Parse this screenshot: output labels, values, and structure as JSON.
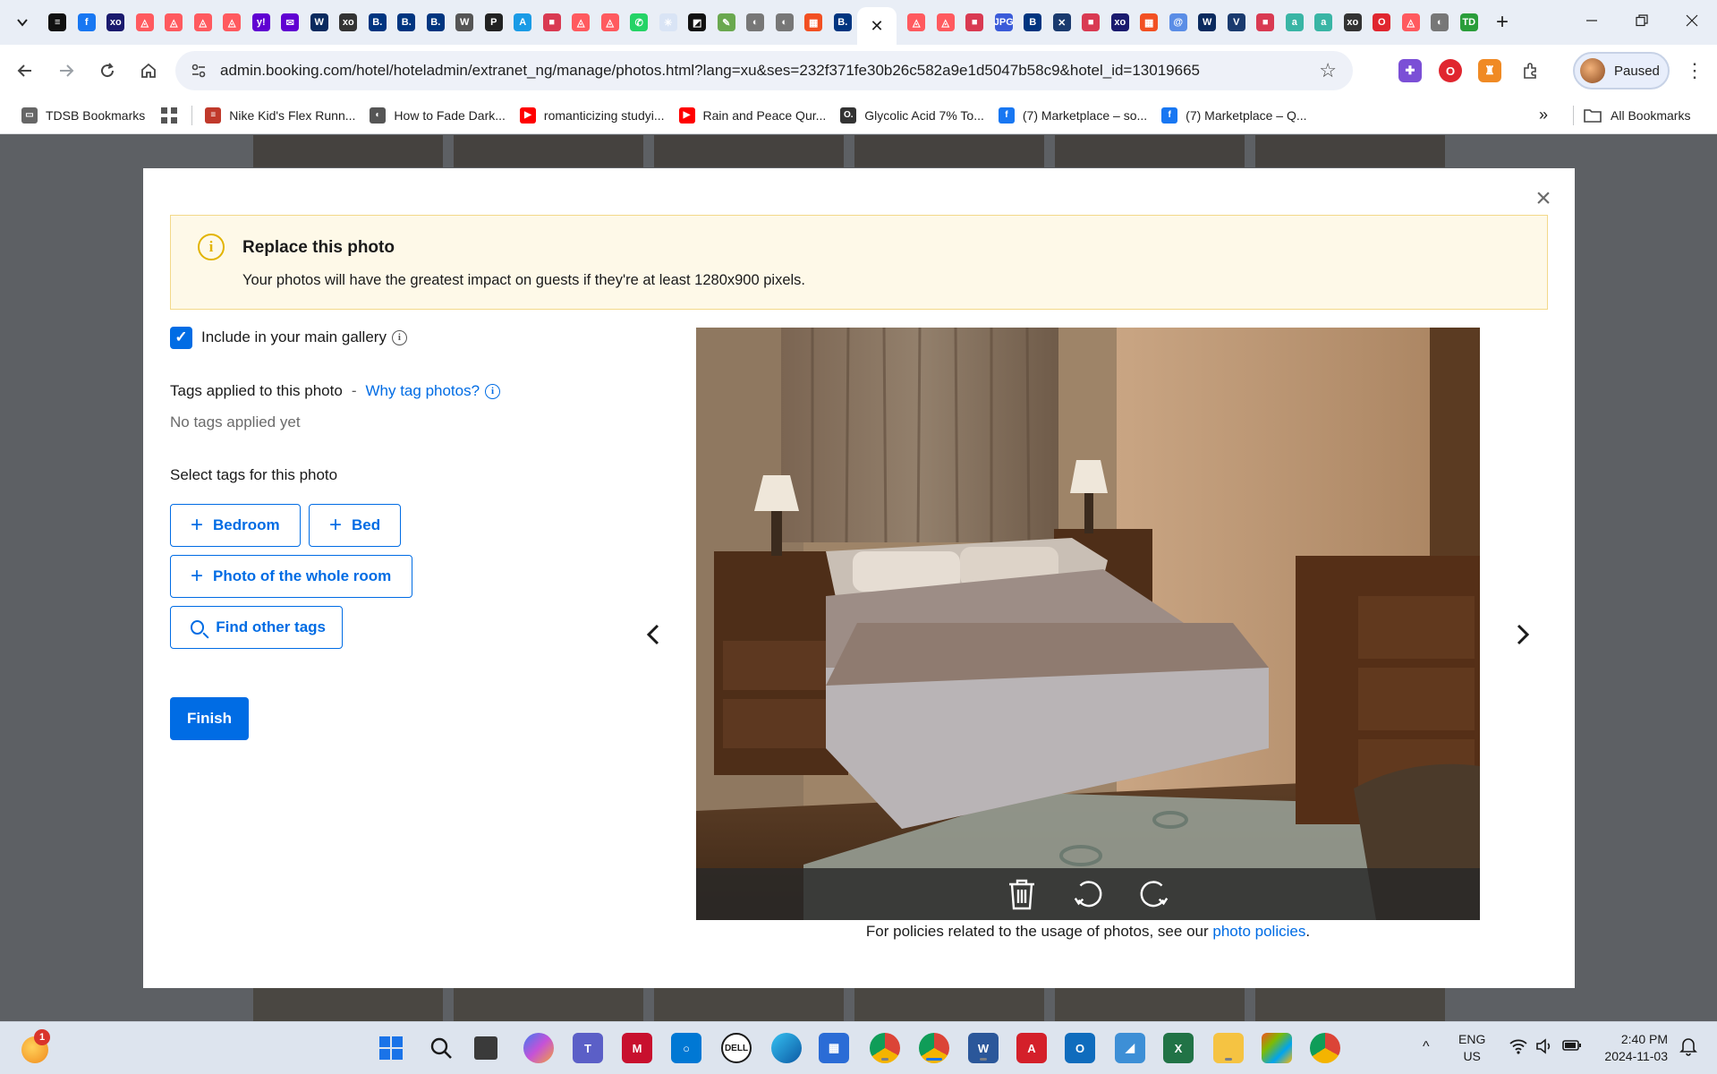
{
  "browser": {
    "active_tab_close": "✕",
    "new_tab": "+",
    "url": "admin.booking.com/hotel/hoteladmin/extranet_ng/manage/photos.html?lang=xu&ses=232f371fe30b26c582a9e1d5047b58c9&hotel_id=13019665",
    "profile_status": "Paused",
    "tabs": [
      {
        "icon": "notion-icon",
        "color": "#111111",
        "glyph": "≡"
      },
      {
        "icon": "facebook-icon",
        "color": "#1877f2",
        "glyph": "f"
      },
      {
        "icon": "xbox-icon",
        "color": "#1a1a6e",
        "glyph": "xo"
      },
      {
        "icon": "airbnb-icon",
        "color": "#ff5a5f",
        "glyph": "◬"
      },
      {
        "icon": "airbnb-icon",
        "color": "#ff5a5f",
        "glyph": "◬"
      },
      {
        "icon": "airbnb-icon",
        "color": "#ff5a5f",
        "glyph": "◬"
      },
      {
        "icon": "airbnb-icon",
        "color": "#ff5a5f",
        "glyph": "◬"
      },
      {
        "icon": "yahoo-icon",
        "color": "#6001d2",
        "glyph": "y!"
      },
      {
        "icon": "mail-icon",
        "color": "#6001d2",
        "glyph": "✉"
      },
      {
        "icon": "w-icon",
        "color": "#0a2a5e",
        "glyph": "W"
      },
      {
        "icon": "xbox-icon",
        "color": "#333333",
        "glyph": "xo"
      },
      {
        "icon": "booking-icon",
        "color": "#003580",
        "glyph": "B."
      },
      {
        "icon": "booking-icon",
        "color": "#003580",
        "glyph": "B."
      },
      {
        "icon": "booking-icon",
        "color": "#003580",
        "glyph": "B."
      },
      {
        "icon": "wp-icon",
        "color": "#555555",
        "glyph": "W"
      },
      {
        "icon": "p-icon",
        "color": "#222222",
        "glyph": "P"
      },
      {
        "icon": "a-icon",
        "color": "#1a9be6",
        "glyph": "A"
      },
      {
        "icon": "red-app-icon",
        "color": "#d93a52",
        "glyph": "■"
      },
      {
        "icon": "airbnb-icon",
        "color": "#ff5a5f",
        "glyph": "◬"
      },
      {
        "icon": "airbnb-icon",
        "color": "#ff5a5f",
        "glyph": "◬"
      },
      {
        "icon": "whatsapp-icon",
        "color": "#25d366",
        "glyph": "✆"
      },
      {
        "icon": "sparkle-icon",
        "color": "#d9e4f5",
        "glyph": "✳"
      },
      {
        "icon": "chart-icon",
        "color": "#111111",
        "glyph": "◩"
      },
      {
        "icon": "leaf-icon",
        "color": "#6aa84f",
        "glyph": "✎"
      },
      {
        "icon": "globe-icon",
        "color": "#777777",
        "glyph": "◐"
      },
      {
        "icon": "globe-icon",
        "color": "#777777",
        "glyph": "◐"
      },
      {
        "icon": "microsoft-icon",
        "color": "#f25022",
        "glyph": "▦"
      },
      {
        "icon": "booking-icon",
        "color": "#003580",
        "glyph": "B."
      }
    ],
    "tabs_after": [
      {
        "icon": "airbnb-icon",
        "color": "#ff5a5f",
        "glyph": "◬"
      },
      {
        "icon": "airbnb-icon",
        "color": "#ff5a5f",
        "glyph": "◬"
      },
      {
        "icon": "red-app-icon",
        "color": "#d93a52",
        "glyph": "■"
      },
      {
        "icon": "jpg-icon",
        "color": "#3a5bd9",
        "glyph": "JPG"
      },
      {
        "icon": "booking-icon",
        "color": "#003580",
        "glyph": "B"
      },
      {
        "icon": "puzzle-icon",
        "color": "#1a3a6e",
        "glyph": "✕"
      },
      {
        "icon": "red-app-icon",
        "color": "#d93a52",
        "glyph": "■"
      },
      {
        "icon": "xbox-icon",
        "color": "#1a1a6e",
        "glyph": "xo"
      },
      {
        "icon": "microsoft-icon",
        "color": "#f25022",
        "glyph": "▦"
      },
      {
        "icon": "at-icon",
        "color": "#5a8de6",
        "glyph": "@"
      },
      {
        "icon": "w-icon",
        "color": "#0a2a5e",
        "glyph": "W"
      },
      {
        "icon": "v-icon",
        "color": "#1a3a6e",
        "glyph": "V"
      },
      {
        "icon": "red-app-icon",
        "color": "#d93a52",
        "glyph": "■"
      },
      {
        "icon": "a-icon",
        "color": "#39b5a5",
        "glyph": "a"
      },
      {
        "icon": "a-icon",
        "color": "#39b5a5",
        "glyph": "a"
      },
      {
        "icon": "xbox-icon",
        "color": "#333333",
        "glyph": "xo"
      },
      {
        "icon": "opera-icon",
        "color": "#e0262f",
        "glyph": "O"
      },
      {
        "icon": "airbnb-icon",
        "color": "#ff5a5f",
        "glyph": "◬"
      },
      {
        "icon": "globe-icon",
        "color": "#777777",
        "glyph": "◐"
      },
      {
        "icon": "td-icon",
        "color": "#2a9d3a",
        "glyph": "TD"
      }
    ]
  },
  "bookmarks": {
    "items": [
      {
        "label": "TDSB Bookmarks",
        "icon": "folder-icon",
        "color": "#666666",
        "glyph": "▭"
      },
      {
        "label": "Nike Kid's Flex Runn...",
        "icon": "nike-icon",
        "color": "#c0392b",
        "glyph": "≡"
      },
      {
        "label": "How to Fade Dark...",
        "icon": "globe-icon",
        "color": "#555555",
        "glyph": "◐"
      },
      {
        "label": "romanticizing studyi...",
        "icon": "youtube-icon",
        "color": "#ff0000",
        "glyph": "▶"
      },
      {
        "label": "Rain and Peace Qur...",
        "icon": "youtube-icon",
        "color": "#ff0000",
        "glyph": "▶"
      },
      {
        "label": "Glycolic Acid 7% To...",
        "icon": "o-icon",
        "color": "#333333",
        "glyph": "O."
      },
      {
        "label": "(7) Marketplace – so...",
        "icon": "facebook-icon",
        "color": "#1877f2",
        "glyph": "f"
      },
      {
        "label": "(7) Marketplace – Q...",
        "icon": "facebook-icon",
        "color": "#1877f2",
        "glyph": "f"
      }
    ],
    "more": "»",
    "all_bookmarks": "All Bookmarks"
  },
  "modal": {
    "notice": {
      "info_glyph": "i",
      "title": "Replace this photo",
      "text": "Your photos will have the greatest impact on guests if they're at least 1280x900 pixels."
    },
    "gallery": {
      "checked": true,
      "check_glyph": "✓",
      "label": "Include in your main gallery"
    },
    "tags": {
      "label": "Tags applied to this photo",
      "separator": "-",
      "why_link": "Why tag photos?",
      "empty": "No tags applied yet",
      "select_label": "Select tags for this photo",
      "buttons": [
        "Bedroom",
        "Bed",
        "Photo of the whole room"
      ],
      "plus": "+",
      "find_label": "Find other tags"
    },
    "finish_label": "Finish",
    "prev_arrow": "‹",
    "next_arrow": "›",
    "close_glyph": "×",
    "policies": {
      "prefix": "For policies related to the usage of photos, see our ",
      "link": "photo policies",
      "suffix": "."
    }
  },
  "taskbar": {
    "notification_count": "1",
    "lang_top": "ENG",
    "lang_bottom": "US",
    "time": "2:40 PM",
    "date": "2024-11-03",
    "chevron": "^"
  }
}
